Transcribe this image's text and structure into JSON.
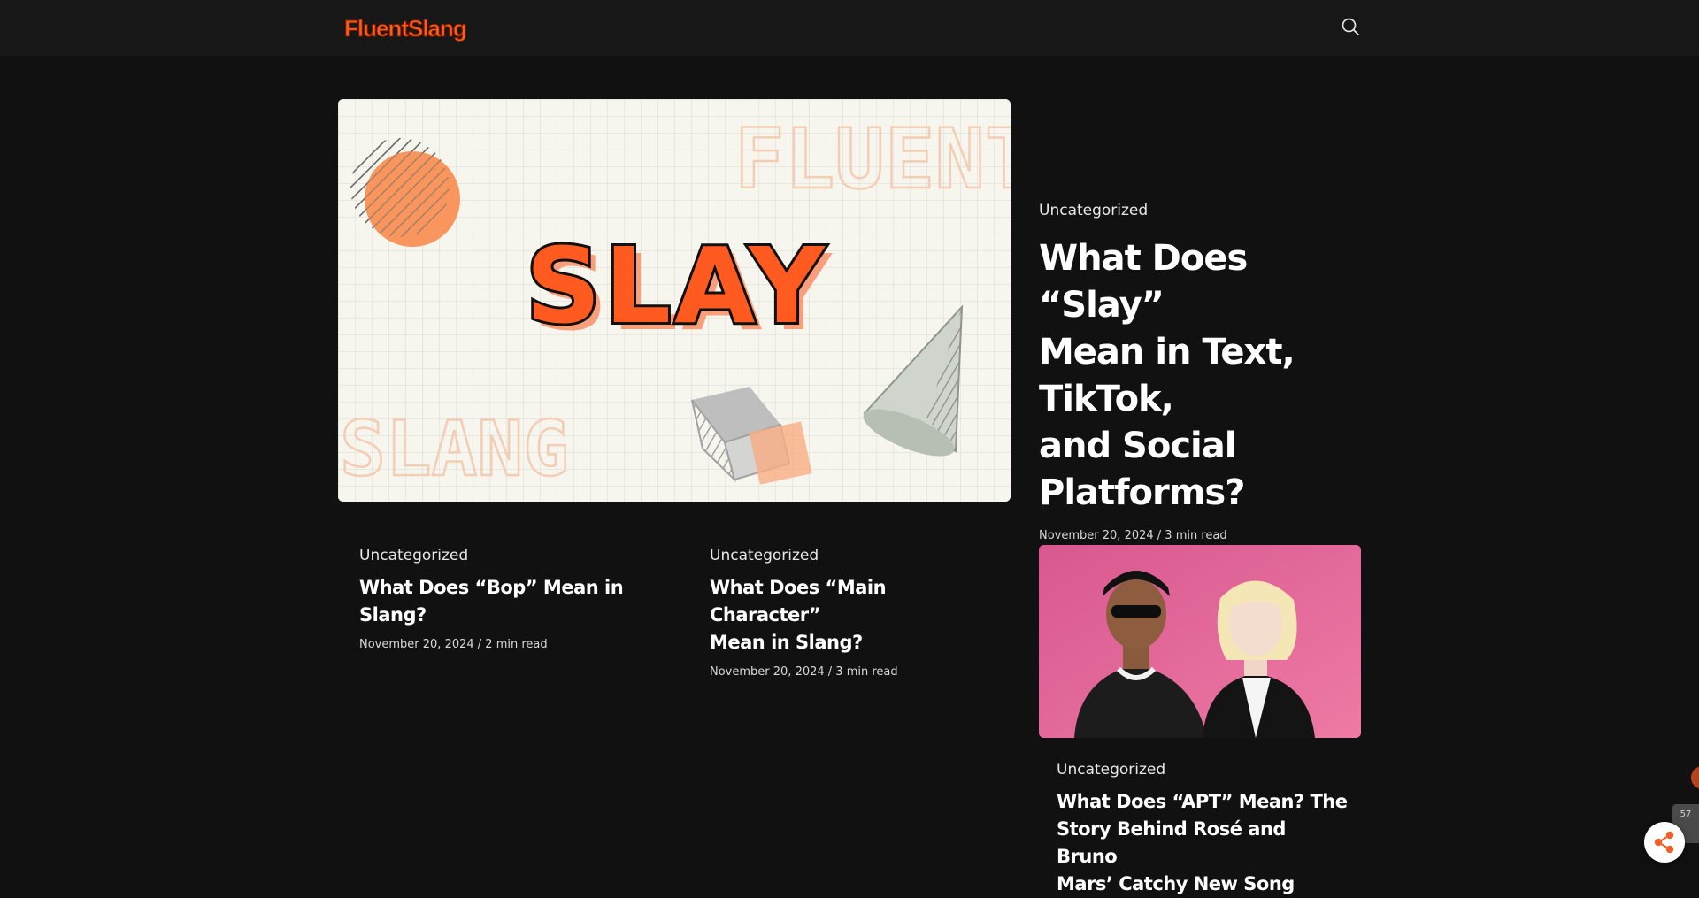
{
  "header": {
    "logo": "FluentSlang",
    "search_icon": "search-icon"
  },
  "hero": {
    "image_text": {
      "main": "SLAY",
      "watermark_top": "FLUENT",
      "watermark_bottom": "SLANG"
    },
    "category": "Uncategorized",
    "title_lines": [
      "What Does “Slay”",
      "Mean in Text, TikTok,",
      "and Social Platforms?"
    ],
    "meta": "November 20, 2024 / 3 min read"
  },
  "posts": [
    {
      "category": "Uncategorized",
      "title_lines": [
        "What Does “Bop” Mean in Slang?"
      ],
      "meta": "November 20, 2024 / 2 min read"
    },
    {
      "category": "Uncategorized",
      "title_lines": [
        "What Does “Main Character”",
        "Mean in Slang?"
      ],
      "meta": "November 20, 2024 / 3 min read"
    },
    {
      "category": "Uncategorized",
      "title_lines": [
        "What Does “APT” Mean? The",
        "Story Behind Rosé and Bruno",
        "Mars’ Catchy New Song"
      ]
    }
  ],
  "share": {
    "count": "57",
    "icon": "share-icon"
  },
  "colors": {
    "background": "#111111",
    "topbar": "#171717",
    "accent": "#ff5a1f"
  }
}
